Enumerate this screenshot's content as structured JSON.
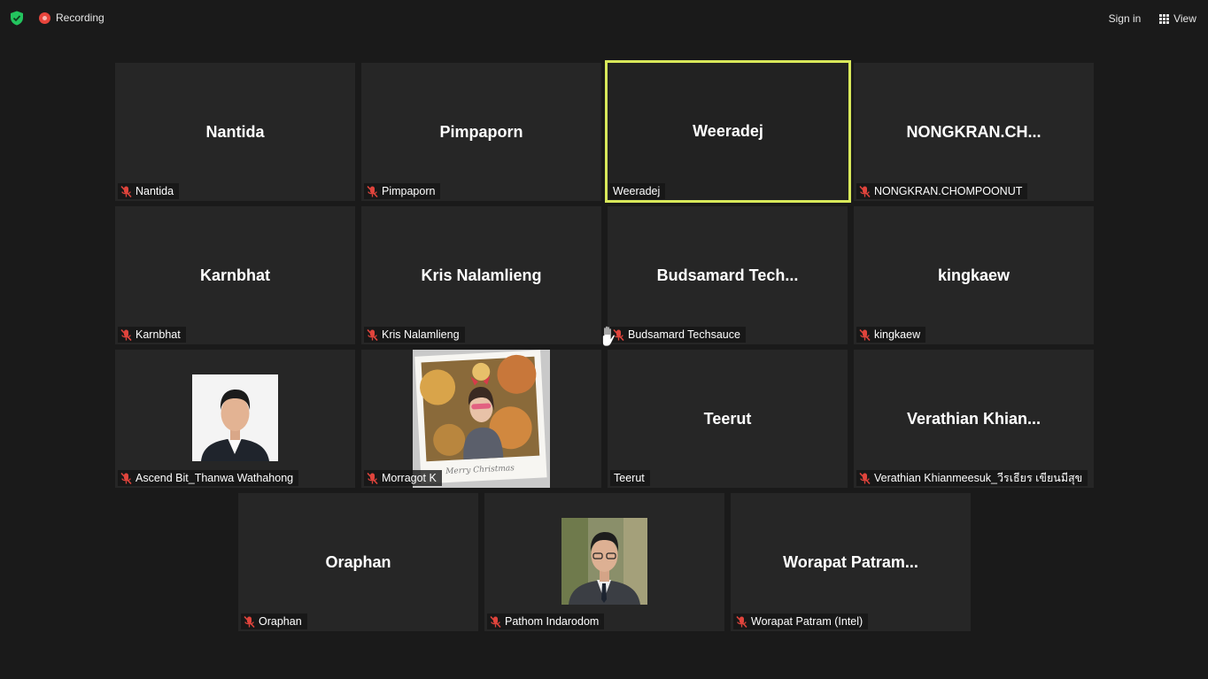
{
  "topbar": {
    "recording_label": "Recording",
    "signin_label": "Sign in",
    "view_label": "View"
  },
  "participants": [
    {
      "display": "Nantida",
      "label": "Nantida",
      "muted": true
    },
    {
      "display": "Pimpaporn",
      "label": "Pimpaporn",
      "muted": true
    },
    {
      "display": "Weeradej",
      "label": "Weeradej",
      "muted": false,
      "active_speaker": true
    },
    {
      "display": "NONGKRAN.CH...",
      "label": "NONGKRAN.CHOMPOONUT",
      "muted": true
    },
    {
      "display": "Karnbhat",
      "label": "Karnbhat",
      "muted": true
    },
    {
      "display": "Kris Nalamlieng",
      "label": "Kris Nalamlieng",
      "muted": true
    },
    {
      "display": "Budsamard Tech...",
      "label": "Budsamard Techsauce",
      "muted": true,
      "hand_raised": true
    },
    {
      "display": "kingkaew",
      "label": "kingkaew",
      "muted": true
    },
    {
      "display": "",
      "label": "Ascend Bit_Thanwa Wathahong",
      "muted": true,
      "photo": "man-portrait-suit"
    },
    {
      "display": "",
      "label": "Morragot K",
      "muted": true,
      "photo": "woman-christmas-polaroid"
    },
    {
      "display": "Teerut",
      "label": "Teerut",
      "muted": false
    },
    {
      "display": "Verathian Khian...",
      "label": "Verathian Khianmeesuk_วีรเธียร เขียนมีสุข",
      "muted": true
    },
    {
      "display": "Oraphan",
      "label": "Oraphan",
      "muted": true
    },
    {
      "display": "",
      "label": "Pathom Indarodom",
      "muted": true,
      "photo": "man-portrait-glasses"
    },
    {
      "display": "Worapat Patram...",
      "label": "Worapat Patram (Intel)",
      "muted": true
    }
  ],
  "colors": {
    "background": "#1a1a1a",
    "tile": "#262626",
    "active_speaker_border": "#d8e85a",
    "muted_icon": "#e0443c",
    "security_shield": "#23c45e"
  },
  "icons": {
    "security": "shield-check-icon",
    "recording": "record-dot-icon",
    "view": "grid-view-icon",
    "muted": "mic-muted-icon",
    "raised_hand": "raised-hand-icon"
  },
  "polaroid_caption": "Merry Christmas"
}
